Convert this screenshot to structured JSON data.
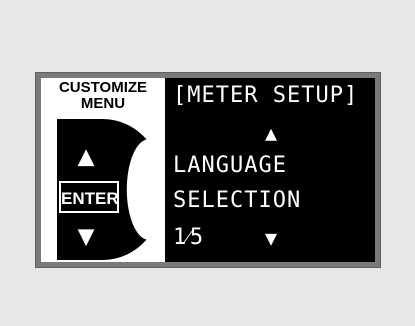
{
  "panel": {
    "title_line1": "CUSTOMIZE",
    "title_line2": "MENU",
    "up_glyph": "▲",
    "enter_label": "ENTER",
    "down_glyph": "▼"
  },
  "display": {
    "header": "[METER SETUP]",
    "scroll_up_glyph": "▲",
    "item_line1": "LANGUAGE",
    "item_line2": "SELECTION",
    "page_indicator": "1⁄5",
    "scroll_down_glyph": "▼"
  },
  "colors": {
    "background": "#e7e7e8",
    "frame": "#7a7a7a",
    "lcd": "#000000",
    "lcd_text": "#ffffff"
  },
  "icons": {
    "up": "up-arrow-icon",
    "down": "down-arrow-icon"
  }
}
